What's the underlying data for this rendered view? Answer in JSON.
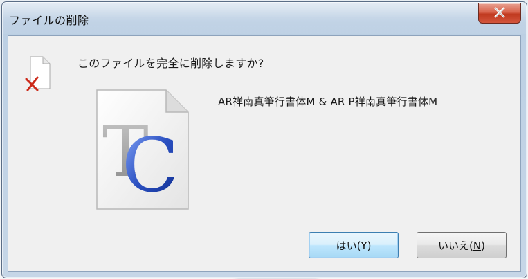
{
  "window": {
    "title": "ファイルの削除"
  },
  "dialog": {
    "question": "このファイルを完全に削除しますか?",
    "file_name": "AR祥南真筆行書体M & AR P祥南真筆行書体M",
    "large_icon_letters": {
      "first": "T",
      "second": "C"
    }
  },
  "buttons": {
    "yes_label": "はい(Y)",
    "no_label_prefix": "いいえ(",
    "no_label_key": "N",
    "no_label_suffix": ")"
  },
  "icons": {
    "close": "close-icon",
    "small_file": "deleted-file-icon",
    "large_file": "truetype-collection-font-icon"
  },
  "colors": {
    "close_button": "#c0391f",
    "title_bar": "#bdd0e4",
    "content_bg": "#f0f0f0",
    "default_button_border": "#3c7fb1",
    "delete_mark": "#cc2a1a",
    "font_icon_blue": "#2a4fc0"
  }
}
